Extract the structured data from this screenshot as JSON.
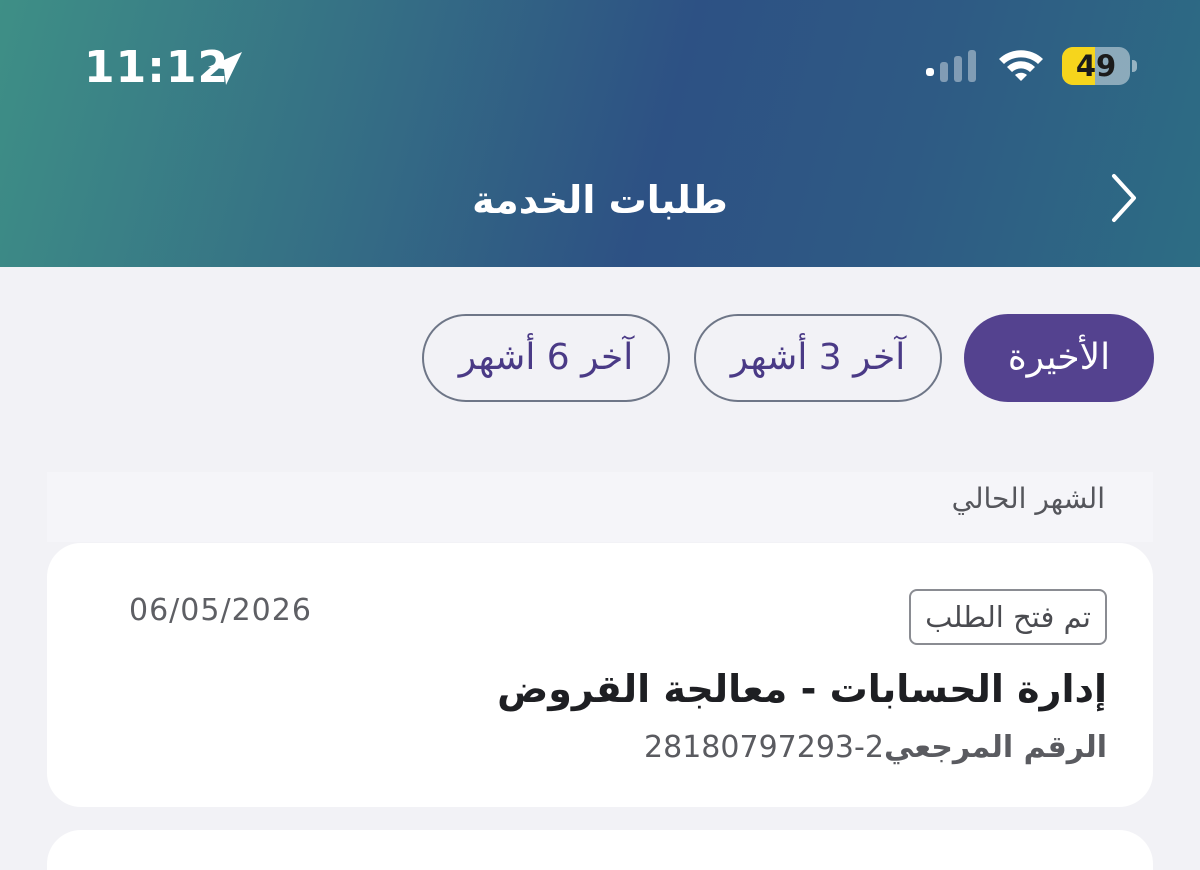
{
  "status_bar": {
    "time": "11:12",
    "battery": "49",
    "battery_level": 0.49,
    "icons": [
      "location-arrow-icon",
      "signal-icon",
      "wifi-icon",
      "battery-icon"
    ]
  },
  "header": {
    "title": "طلبات الخدمة",
    "back_icon": "chevron-right-icon"
  },
  "tabs": [
    {
      "label": "الأخيرة",
      "active": true
    },
    {
      "label": "آخر 3 أشهر",
      "active": false
    },
    {
      "label": "آخر 6 أشهر",
      "active": false
    }
  ],
  "section": {
    "label": "الشهر الحالي"
  },
  "requests": [
    {
      "status": "تم فتح الطلب",
      "date": "06/05/2026",
      "title": "إدارة الحسابات - معالجة القروض",
      "reference_label": "الرقم المرجعي",
      "reference_number": "2-28180797293"
    }
  ],
  "colors": {
    "header_gradient_start": "#3e8f86",
    "header_gradient_mid": "#2d5184",
    "active_tab": "#54428f",
    "tab_text": "#4a3a86",
    "page_background": "#f2f2f6",
    "battery_fill": "#f6d51c"
  }
}
